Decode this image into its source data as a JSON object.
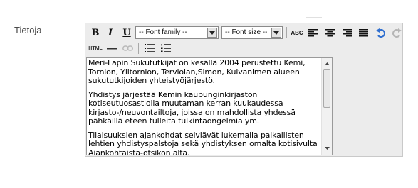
{
  "field": {
    "label": "Tietoja"
  },
  "toolbar": {
    "bold": "B",
    "italic": "I",
    "underline": "U",
    "font_family": "-- Font family --",
    "font_size": "-- Font size --",
    "strikethrough": "ABC",
    "html": "HTML"
  },
  "content": {
    "paragraphs": [
      "Meri-Lapin Sukututkijat on kesällä 2004 perustettu Kemi, Tornion, Ylitornion, Terviolan,Simon, Kuivanimen alueen sukututkijoiden yhteistyöjärjestö.",
      "Yhdistys järjestää Kemin kaupunginkirjaston kotiseutuosastiolla muutaman kerran kuukaudessa kirjasto-/neuvontailtoja, joissa on mahdollista yhdessä pähkäillä eteen tulleita tulkintaongelmia ym.",
      "Tilaisuuksien ajankohdat selviävät lukemalla paikallisten lehtien yhdistyspalstoja sekä yhdistyksen omalta kotisivulta Ajankohtaista-otsikon alta."
    ]
  },
  "colors": {
    "accent_blue": "#2f6fd0",
    "disabled": "#b5b5b5"
  }
}
